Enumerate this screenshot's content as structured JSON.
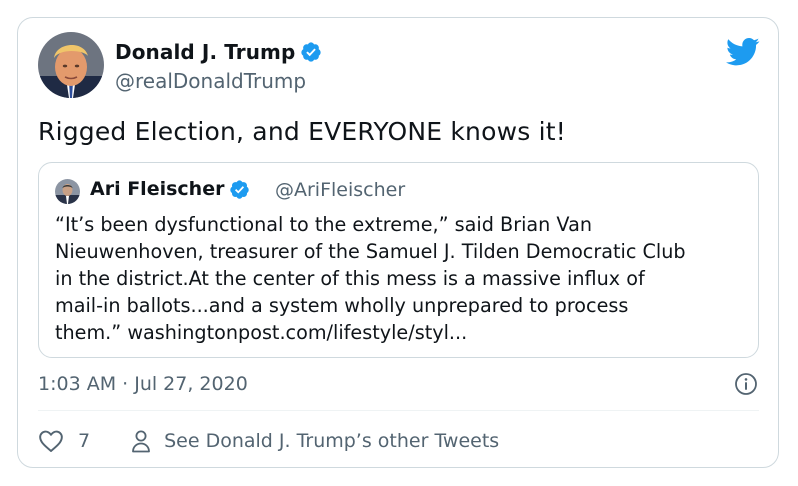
{
  "author": {
    "name": "Donald J. Trump",
    "handle": "@realDonaldTrump",
    "verified": true
  },
  "tweet": {
    "text": "Rigged Election, and EVERYONE knows it!"
  },
  "quoted_tweet": {
    "author_name": "Ari Fleischer",
    "author_handle": "@AriFleischer",
    "verified": true,
    "text": "“It’s been dysfunctional to the extreme,” said Brian Van\nNieuwenhoven, treasurer of the Samuel J. Tilden Democratic Club\nin the district.At the center of this mess is a massive influx of\nmail-in ballots...and a system wholly unprepared to process\nthem.” washingtonpost.com/lifestyle/styl..."
  },
  "meta": {
    "timestamp": "1:03 AM · Jul 27, 2020"
  },
  "actions": {
    "like_count": "7",
    "profile_link_label": "See Donald J. Trump’s other Tweets"
  },
  "icons": {
    "brand": "twitter-bird-icon",
    "verified": "verified-badge-icon",
    "info": "info-icon",
    "like": "heart-icon",
    "profile": "person-icon"
  },
  "colors": {
    "twitter_blue": "#1d9bf0",
    "text_primary": "#0f1419",
    "text_secondary": "#536471",
    "border": "#cfd9de"
  }
}
